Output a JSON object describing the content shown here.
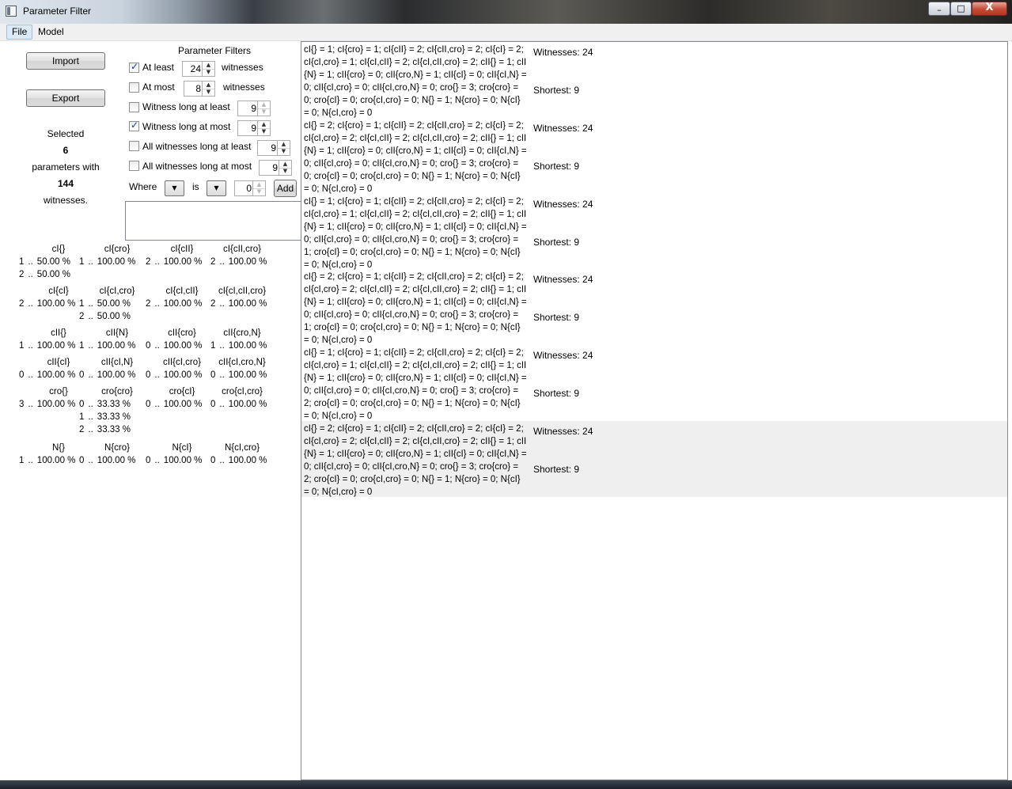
{
  "window": {
    "title": "Parameter Filter",
    "minimize_glyph": "–",
    "maximize_glyph": "□",
    "close_glyph": "X"
  },
  "menu": {
    "file": "File",
    "model": "Model"
  },
  "actions": {
    "import_label": "Import",
    "export_label": "Export"
  },
  "selection": {
    "selected_label": "Selected",
    "param_count": "6",
    "params_with_label": "parameters with",
    "witness_count": "144",
    "witnesses_label": "witnesses."
  },
  "filters": {
    "heading": "Parameter Filters",
    "at_least": {
      "label": "At least",
      "checked": true,
      "value": "24",
      "suffix": "witnesses"
    },
    "at_most": {
      "label": "At most",
      "checked": false,
      "value": "8",
      "suffix": "witnesses"
    },
    "witness_long_at_least": {
      "label": "Witness long at least",
      "checked": false,
      "value": "9"
    },
    "witness_long_at_most": {
      "label": "Witness long at most",
      "checked": true,
      "value": "9"
    },
    "all_long_at_least": {
      "label": "All witnesses long at least",
      "checked": false,
      "value": "9"
    },
    "all_long_at_most": {
      "label": "All witnesses long at most",
      "checked": false,
      "value": "9"
    },
    "where_label": "Where",
    "is_label": "is",
    "where_value": "0",
    "add_label": "Add"
  },
  "param_tables": [
    {
      "columns": [
        {
          "name": "cI{}",
          "rows": [
            [
              "1",
              "..",
              "50.00 %"
            ],
            [
              "2",
              "..",
              "50.00 %"
            ]
          ]
        },
        {
          "name": "cI{cro}",
          "rows": [
            [
              "1",
              "..",
              "100.00 %"
            ]
          ]
        },
        {
          "name": "cI{cII}",
          "rows": [
            [
              "2",
              "..",
              "100.00 %"
            ]
          ]
        },
        {
          "name": "cI{cII,cro}",
          "rows": [
            [
              "2",
              "..",
              "100.00 %"
            ]
          ]
        }
      ]
    },
    {
      "columns": [
        {
          "name": "cI{cI}",
          "rows": [
            [
              "2",
              "..",
              "100.00 %"
            ]
          ]
        },
        {
          "name": "cI{cI,cro}",
          "rows": [
            [
              "1",
              "..",
              "50.00 %"
            ],
            [
              "2",
              "..",
              "50.00 %"
            ]
          ]
        },
        {
          "name": "cI{cI,cII}",
          "rows": [
            [
              "2",
              "..",
              "100.00 %"
            ]
          ]
        },
        {
          "name": "cI{cI,cII,cro}",
          "rows": [
            [
              "2",
              "..",
              "100.00 %"
            ]
          ]
        }
      ]
    },
    {
      "columns": [
        {
          "name": "cII{}",
          "rows": [
            [
              "1",
              "..",
              "100.00 %"
            ]
          ]
        },
        {
          "name": "cII{N}",
          "rows": [
            [
              "1",
              "..",
              "100.00 %"
            ]
          ]
        },
        {
          "name": "cII{cro}",
          "rows": [
            [
              "0",
              "..",
              "100.00 %"
            ]
          ]
        },
        {
          "name": "cII{cro,N}",
          "rows": [
            [
              "1",
              "..",
              "100.00 %"
            ]
          ]
        }
      ]
    },
    {
      "columns": [
        {
          "name": "cII{cI}",
          "rows": [
            [
              "0",
              "..",
              "100.00 %"
            ]
          ]
        },
        {
          "name": "cII{cI,N}",
          "rows": [
            [
              "0",
              "..",
              "100.00 %"
            ]
          ]
        },
        {
          "name": "cII{cI,cro}",
          "rows": [
            [
              "0",
              "..",
              "100.00 %"
            ]
          ]
        },
        {
          "name": "cII{cI,cro,N}",
          "rows": [
            [
              "0",
              "..",
              "100.00 %"
            ]
          ]
        }
      ]
    },
    {
      "columns": [
        {
          "name": "cro{}",
          "rows": [
            [
              "3",
              "..",
              "100.00 %"
            ]
          ]
        },
        {
          "name": "cro{cro}",
          "rows": [
            [
              "0",
              "..",
              "33.33 %"
            ],
            [
              "1",
              "..",
              "33.33 %"
            ],
            [
              "2",
              "..",
              "33.33 %"
            ]
          ]
        },
        {
          "name": "cro{cI}",
          "rows": [
            [
              "0",
              "..",
              "100.00 %"
            ]
          ]
        },
        {
          "name": "cro{cI,cro}",
          "rows": [
            [
              "0",
              "..",
              "100.00 %"
            ]
          ]
        }
      ]
    },
    {
      "columns": [
        {
          "name": "N{}",
          "rows": [
            [
              "1",
              "..",
              "100.00 %"
            ]
          ]
        },
        {
          "name": "N{cro}",
          "rows": [
            [
              "0",
              "..",
              "100.00 %"
            ]
          ]
        },
        {
          "name": "N{cI}",
          "rows": [
            [
              "0",
              "..",
              "100.00 %"
            ]
          ]
        },
        {
          "name": "N{cI,cro}",
          "rows": [
            [
              "0",
              "..",
              "100.00 %"
            ]
          ]
        }
      ]
    }
  ],
  "witness_rows": [
    {
      "text": "cI{} = 1; cI{cro} = 1; cI{cII} = 2; cI{cII,cro} = 2; cI{cI} = 2; cI{cI,cro} = 1; cI{cI,cII} = 2; cI{cI,cII,cro} = 2; cII{} = 1; cII{N} = 1; cII{cro} = 0; cII{cro,N} = 1; cII{cI} = 0; cII{cI,N} = 0; cII{cI,cro} = 0; cII{cI,cro,N} = 0; cro{} = 3; cro{cro} = 0; cro{cI} = 0; cro{cI,cro} = 0; N{} = 1; N{cro} = 0; N{cI} = 0; N{cI,cro} = 0",
      "witnesses": "Witnesses: 24",
      "shortest": "Shortest: 9"
    },
    {
      "text": "cI{} = 2; cI{cro} = 1; cI{cII} = 2; cI{cII,cro} = 2; cI{cI} = 2; cI{cI,cro} = 2; cI{cI,cII} = 2; cI{cI,cII,cro} = 2; cII{} = 1; cII{N} = 1; cII{cro} = 0; cII{cro,N} = 1; cII{cI} = 0; cII{cI,N} = 0; cII{cI,cro} = 0; cII{cI,cro,N} = 0; cro{} = 3; cro{cro} = 0; cro{cI} = 0; cro{cI,cro} = 0; N{} = 1; N{cro} = 0; N{cI} = 0; N{cI,cro} = 0",
      "witnesses": "Witnesses: 24",
      "shortest": "Shortest: 9"
    },
    {
      "text": "cI{} = 1; cI{cro} = 1; cI{cII} = 2; cI{cII,cro} = 2; cI{cI} = 2; cI{cI,cro} = 1; cI{cI,cII} = 2; cI{cI,cII,cro} = 2; cII{} = 1; cII{N} = 1; cII{cro} = 0; cII{cro,N} = 1; cII{cI} = 0; cII{cI,N} = 0; cII{cI,cro} = 0; cII{cI,cro,N} = 0; cro{} = 3; cro{cro} = 1; cro{cI} = 0; cro{cI,cro} = 0; N{} = 1; N{cro} = 0; N{cI} = 0; N{cI,cro} = 0",
      "witnesses": "Witnesses: 24",
      "shortest": "Shortest: 9"
    },
    {
      "text": "cI{} = 2; cI{cro} = 1; cI{cII} = 2; cI{cII,cro} = 2; cI{cI} = 2; cI{cI,cro} = 2; cI{cI,cII} = 2; cI{cI,cII,cro} = 2; cII{} = 1; cII{N} = 1; cII{cro} = 0; cII{cro,N} = 1; cII{cI} = 0; cII{cI,N} = 0; cII{cI,cro} = 0; cII{cI,cro,N} = 0; cro{} = 3; cro{cro} = 1; cro{cI} = 0; cro{cI,cro} = 0; N{} = 1; N{cro} = 0; N{cI} = 0; N{cI,cro} = 0",
      "witnesses": "Witnesses: 24",
      "shortest": "Shortest: 9"
    },
    {
      "text": "cI{} = 1; cI{cro} = 1; cI{cII} = 2; cI{cII,cro} = 2; cI{cI} = 2; cI{cI,cro} = 1; cI{cI,cII} = 2; cI{cI,cII,cro} = 2; cII{} = 1; cII{N} = 1; cII{cro} = 0; cII{cro,N} = 1; cII{cI} = 0; cII{cI,N} = 0; cII{cI,cro} = 0; cII{cI,cro,N} = 0; cro{} = 3; cro{cro} = 2; cro{cI} = 0; cro{cI,cro} = 0; N{} = 1; N{cro} = 0; N{cI} = 0; N{cI,cro} = 0",
      "witnesses": "Witnesses: 24",
      "shortest": "Shortest: 9"
    },
    {
      "text": "cI{} = 2; cI{cro} = 1; cI{cII} = 2; cI{cII,cro} = 2; cI{cI} = 2; cI{cI,cro} = 2; cI{cI,cII} = 2; cI{cI,cII,cro} = 2; cII{} = 1; cII{N} = 1; cII{cro} = 0; cII{cro,N} = 1; cII{cI} = 0; cII{cI,N} = 0; cII{cI,cro} = 0; cII{cI,cro,N} = 0; cro{} = 3; cro{cro} = 2; cro{cI} = 0; cro{cI,cro} = 0; N{} = 1; N{cro} = 0; N{cI} = 0; N{cI,cro} = 0",
      "witnesses": "Witnesses: 24",
      "shortest": "Shortest: 9",
      "selected": true
    }
  ],
  "icons": {
    "app": "window-icon",
    "spin_up": "▲",
    "spin_down": "▼",
    "combo_arrow": "▼"
  }
}
